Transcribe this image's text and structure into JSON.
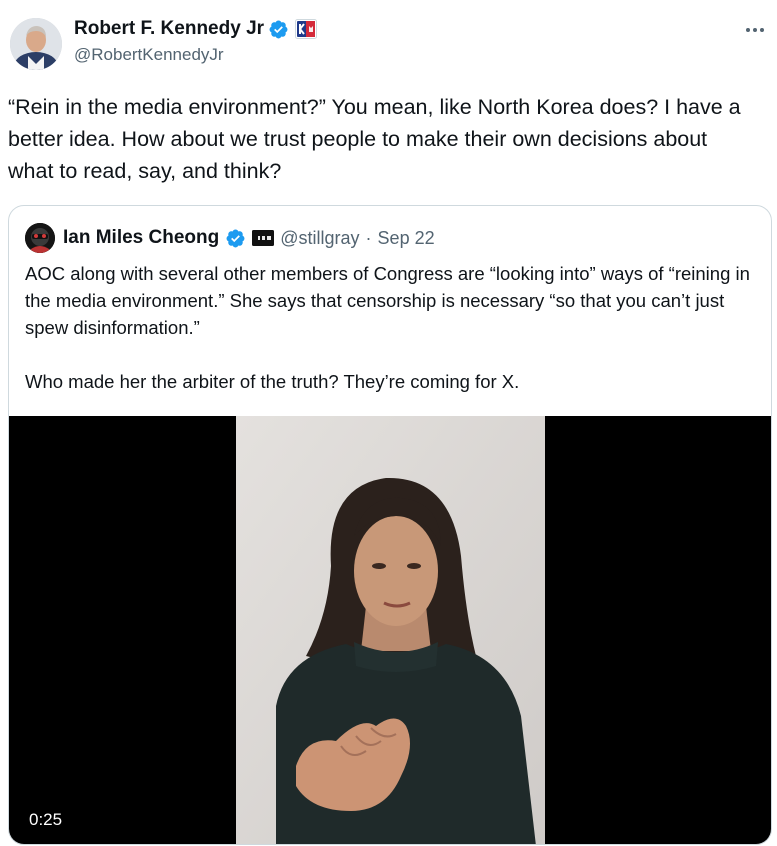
{
  "tweet": {
    "author_name": "Robert F. Kennedy Jr",
    "author_handle": "@RobertKennedyJr",
    "text": "“Rein in the media environment?” You mean, like North Korea does? I have a better idea. How about we trust people to make their own decisions about what to read, say, and think?",
    "more_icon": "more-horizontal-icon",
    "verified_color": "#1d9bf0"
  },
  "quote": {
    "author_name": "Ian Miles Cheong",
    "author_handle": "@stillgray",
    "separator": "·",
    "date": "Sep 22",
    "paragraph1": "AOC along with several other members of Congress are “looking into” ways of “reining in the media environment.” She says that censorship is necessary “so that you can’t just spew disinformation.”",
    "paragraph2": "Who made her the arbiter of the truth? They’re coming for X."
  },
  "video": {
    "duration": "0:25"
  },
  "colors": {
    "text_primary": "#0f1419",
    "text_secondary": "#536471",
    "border": "#cfd9de",
    "verified": "#1d9bf0"
  }
}
